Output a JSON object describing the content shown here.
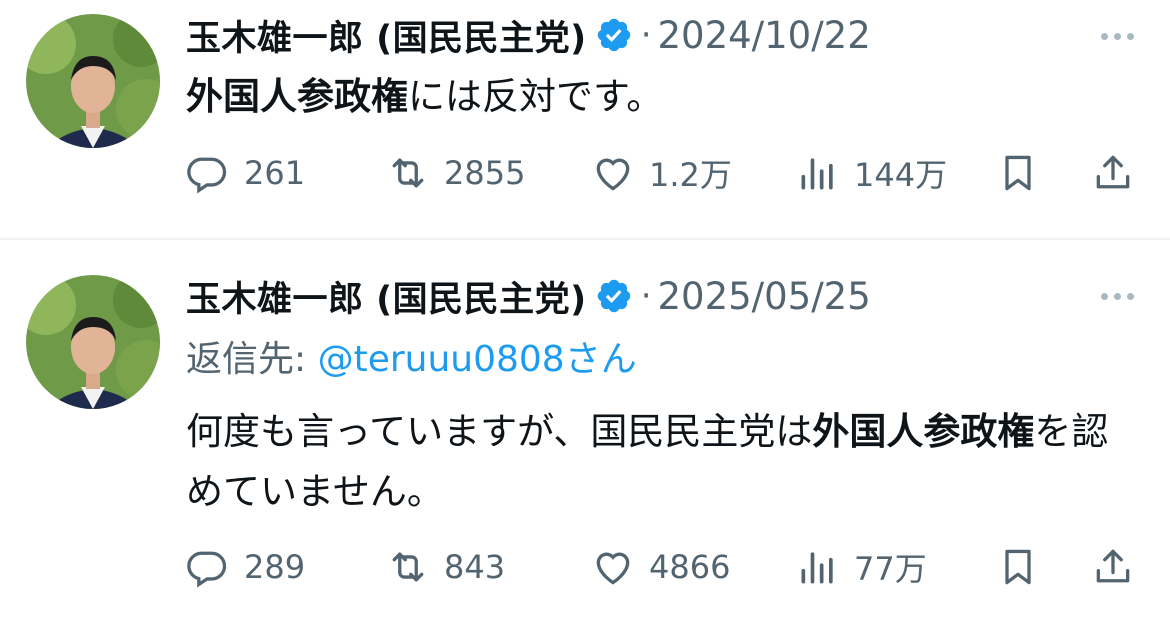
{
  "tweets": [
    {
      "author": "玉木雄一郎 (国民民主党)",
      "date": "2024/10/22",
      "reply_label": "",
      "reply_handle": "",
      "reply_suffix": "",
      "text": {
        "b1": "外国人参政権",
        "t1": "には反対です。",
        "b2": "",
        "t2": ""
      },
      "counts": {
        "replies": "261",
        "retweets": "2855",
        "likes": "1.2万",
        "views": "144万"
      }
    },
    {
      "author": "玉木雄一郎 (国民民主党)",
      "date": "2025/05/25",
      "reply_label": "返信先: ",
      "reply_handle": "@teruuu0808",
      "reply_suffix": "さん",
      "text": {
        "t0": "何度も言っていますが、国民民主党は",
        "b1": "外国人参政権",
        "t1": "を認めていません。"
      },
      "counts": {
        "replies": "289",
        "retweets": "843",
        "likes": "4866",
        "views": "77万"
      }
    }
  ],
  "colors": {
    "text": "#0f1419",
    "muted": "#536471",
    "link": "#1d9bf0",
    "verified": "#1d9bf0"
  },
  "icons": [
    "reply-icon",
    "retweet-icon",
    "like-icon",
    "views-icon",
    "bookmark-icon",
    "share-icon",
    "verified-badge-icon",
    "more-icon"
  ]
}
